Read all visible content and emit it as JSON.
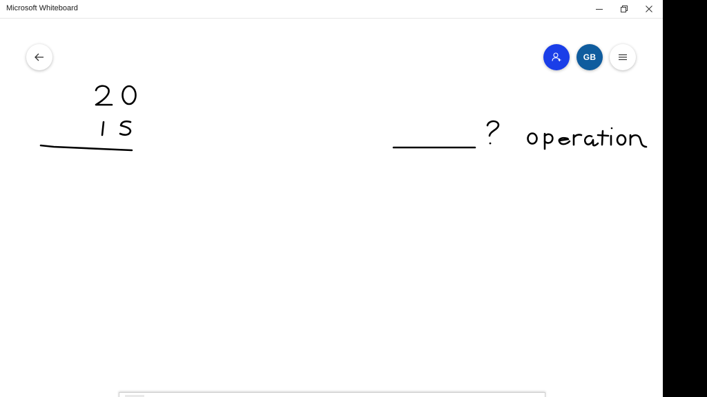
{
  "window": {
    "title": "Microsoft Whiteboard",
    "controls": [
      "minimize",
      "restore",
      "close"
    ]
  },
  "header": {
    "back_icon": "arrow-left-icon",
    "invite_icon": "person-add-icon",
    "invite_color": "#1a3ee8",
    "avatar_initials": "GB",
    "avatar_color": "#0f5c9e",
    "menu_icon": "hamburger-icon"
  },
  "canvas": {
    "ink_color": "#000000",
    "handwritten": {
      "top_number": "20",
      "bottom_number": "15",
      "question_mark": "?",
      "word": "operation"
    }
  },
  "toolbar": {
    "state": "partially visible at bottom edge"
  }
}
